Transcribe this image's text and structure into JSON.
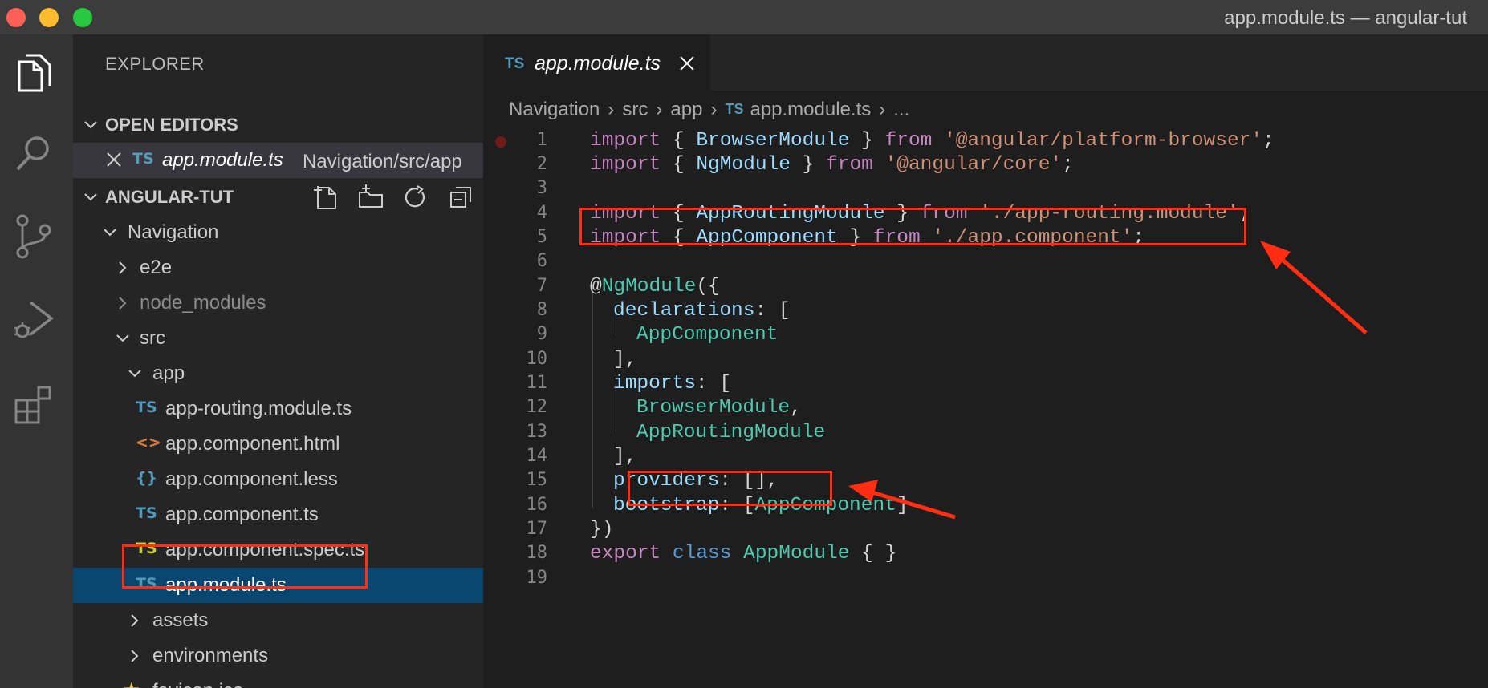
{
  "window": {
    "title": "app.module.ts — angular-tut"
  },
  "activity_bar": {
    "icons": [
      "explorer-icon",
      "search-icon",
      "source-control-icon",
      "run-debug-icon",
      "extensions-icon"
    ]
  },
  "sidebar": {
    "title": "EXPLORER",
    "open_editors": {
      "label": "OPEN EDITORS",
      "items": [
        {
          "icon": "TS",
          "name": "app.module.ts",
          "path": "Navigation/src/app"
        }
      ]
    },
    "workspace": {
      "label": "ANGULAR-TUT",
      "actions": [
        "new-file-icon",
        "new-folder-icon",
        "refresh-icon",
        "collapse-all-icon"
      ],
      "tree": [
        {
          "name": "Navigation",
          "type": "folder",
          "expanded": true
        },
        {
          "name": "e2e",
          "type": "folder",
          "expanded": false
        },
        {
          "name": "node_modules",
          "type": "folder",
          "expanded": false
        },
        {
          "name": "src",
          "type": "folder",
          "expanded": true
        },
        {
          "name": "app",
          "type": "folder",
          "expanded": true
        },
        {
          "name": "app-routing.module.ts",
          "type": "file",
          "icon": "TS"
        },
        {
          "name": "app.component.html",
          "type": "file",
          "icon": "<>"
        },
        {
          "name": "app.component.less",
          "type": "file",
          "icon": "{}"
        },
        {
          "name": "app.component.ts",
          "type": "file",
          "icon": "TS"
        },
        {
          "name": "app.component.spec.ts",
          "type": "file",
          "icon": "TS"
        },
        {
          "name": "app.module.ts",
          "type": "file",
          "icon": "TS",
          "selected": true
        },
        {
          "name": "assets",
          "type": "folder",
          "expanded": false
        },
        {
          "name": "environments",
          "type": "folder",
          "expanded": false
        },
        {
          "name": "favicon.ico",
          "type": "file",
          "icon": "★"
        }
      ]
    }
  },
  "editor": {
    "tab": {
      "icon": "TS",
      "name": "app.module.ts"
    },
    "breadcrumb": [
      "Navigation",
      "src",
      "app",
      "app.module.ts",
      "..."
    ],
    "breadcrumb_file_icon": "TS",
    "line_numbers": [
      "1",
      "2",
      "3",
      "4",
      "5",
      "6",
      "7",
      "8",
      "9",
      "10",
      "11",
      "12",
      "13",
      "14",
      "15",
      "16",
      "17",
      "18",
      "19"
    ],
    "code": {
      "l1": [
        "import",
        " { ",
        "BrowserModule",
        " } ",
        "from",
        " ",
        "'@angular/platform-browser'",
        ";"
      ],
      "l2": [
        "import",
        " { ",
        "NgModule",
        " } ",
        "from",
        " ",
        "'@angular/core'",
        ";"
      ],
      "l4": [
        "import",
        " { ",
        "AppRoutingModule",
        " } ",
        "from",
        " ",
        "'./app-routing.module'",
        ";"
      ],
      "l5": [
        "import",
        " { ",
        "AppComponent",
        " } ",
        "from",
        " ",
        "'./app.component'",
        ";"
      ],
      "l7": [
        "@",
        "NgModule",
        "({"
      ],
      "l8": [
        "declarations",
        ": ["
      ],
      "l9": [
        "AppComponent"
      ],
      "l10": [
        "],"
      ],
      "l11": [
        "imports",
        ": ["
      ],
      "l12": [
        "BrowserModule",
        ","
      ],
      "l13": [
        "AppRoutingModule"
      ],
      "l14": [
        "],"
      ],
      "l15": [
        "providers",
        ": [],"
      ],
      "l16": [
        "bootstrap",
        ": [",
        "AppComponent",
        "]"
      ],
      "l17": [
        "})"
      ],
      "l18": [
        "export",
        " ",
        "class",
        " ",
        "AppModule",
        " { }"
      ]
    }
  },
  "colors": {
    "annotation": "#ff2d12",
    "selection": "#094771",
    "keyword": "#c586c0",
    "type": "#4ec9b0",
    "string": "#ce9178"
  }
}
